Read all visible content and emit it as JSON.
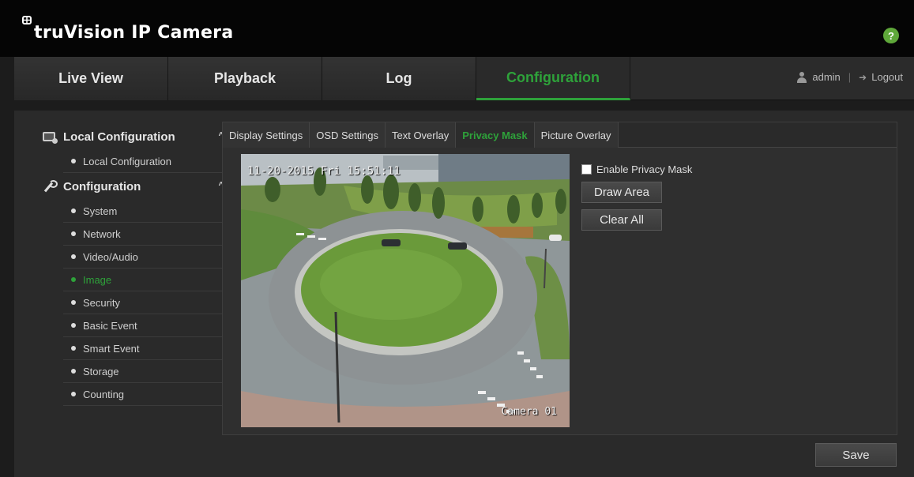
{
  "app": {
    "brand": "truVision IP Camera",
    "help_symbol": "?"
  },
  "nav": {
    "tabs": [
      {
        "label": "Live View"
      },
      {
        "label": "Playback"
      },
      {
        "label": "Log"
      },
      {
        "label": "Configuration",
        "active": true
      }
    ],
    "user": "admin",
    "separator": "|",
    "logout": "Logout"
  },
  "sidebar": {
    "groups": [
      {
        "label": "Local Configuration",
        "caret": "^",
        "items": [
          "Local Configuration"
        ]
      },
      {
        "label": "Configuration",
        "caret": "^",
        "items": [
          "System",
          "Network",
          "Video/Audio",
          "Image",
          "Security",
          "Basic Event",
          "Smart Event",
          "Storage",
          "Counting"
        ],
        "active_item": "Image"
      }
    ]
  },
  "subtabs": [
    "Display Settings",
    "OSD Settings",
    "Text Overlay",
    "Privacy Mask",
    "Picture Overlay"
  ],
  "active_subtab": "Privacy Mask",
  "video": {
    "osd_date": "11-20-2015 Fri 15:51:11",
    "osd_name": "Camera 01"
  },
  "privacy_mask": {
    "enable_label": "Enable Privacy Mask",
    "enabled": false,
    "draw_area": "Draw Area",
    "clear_all": "Clear All"
  },
  "save_label": "Save",
  "colors": {
    "accent": "#2ea23a",
    "background": "#1c1c1c",
    "panel": "#2a2a2a"
  }
}
